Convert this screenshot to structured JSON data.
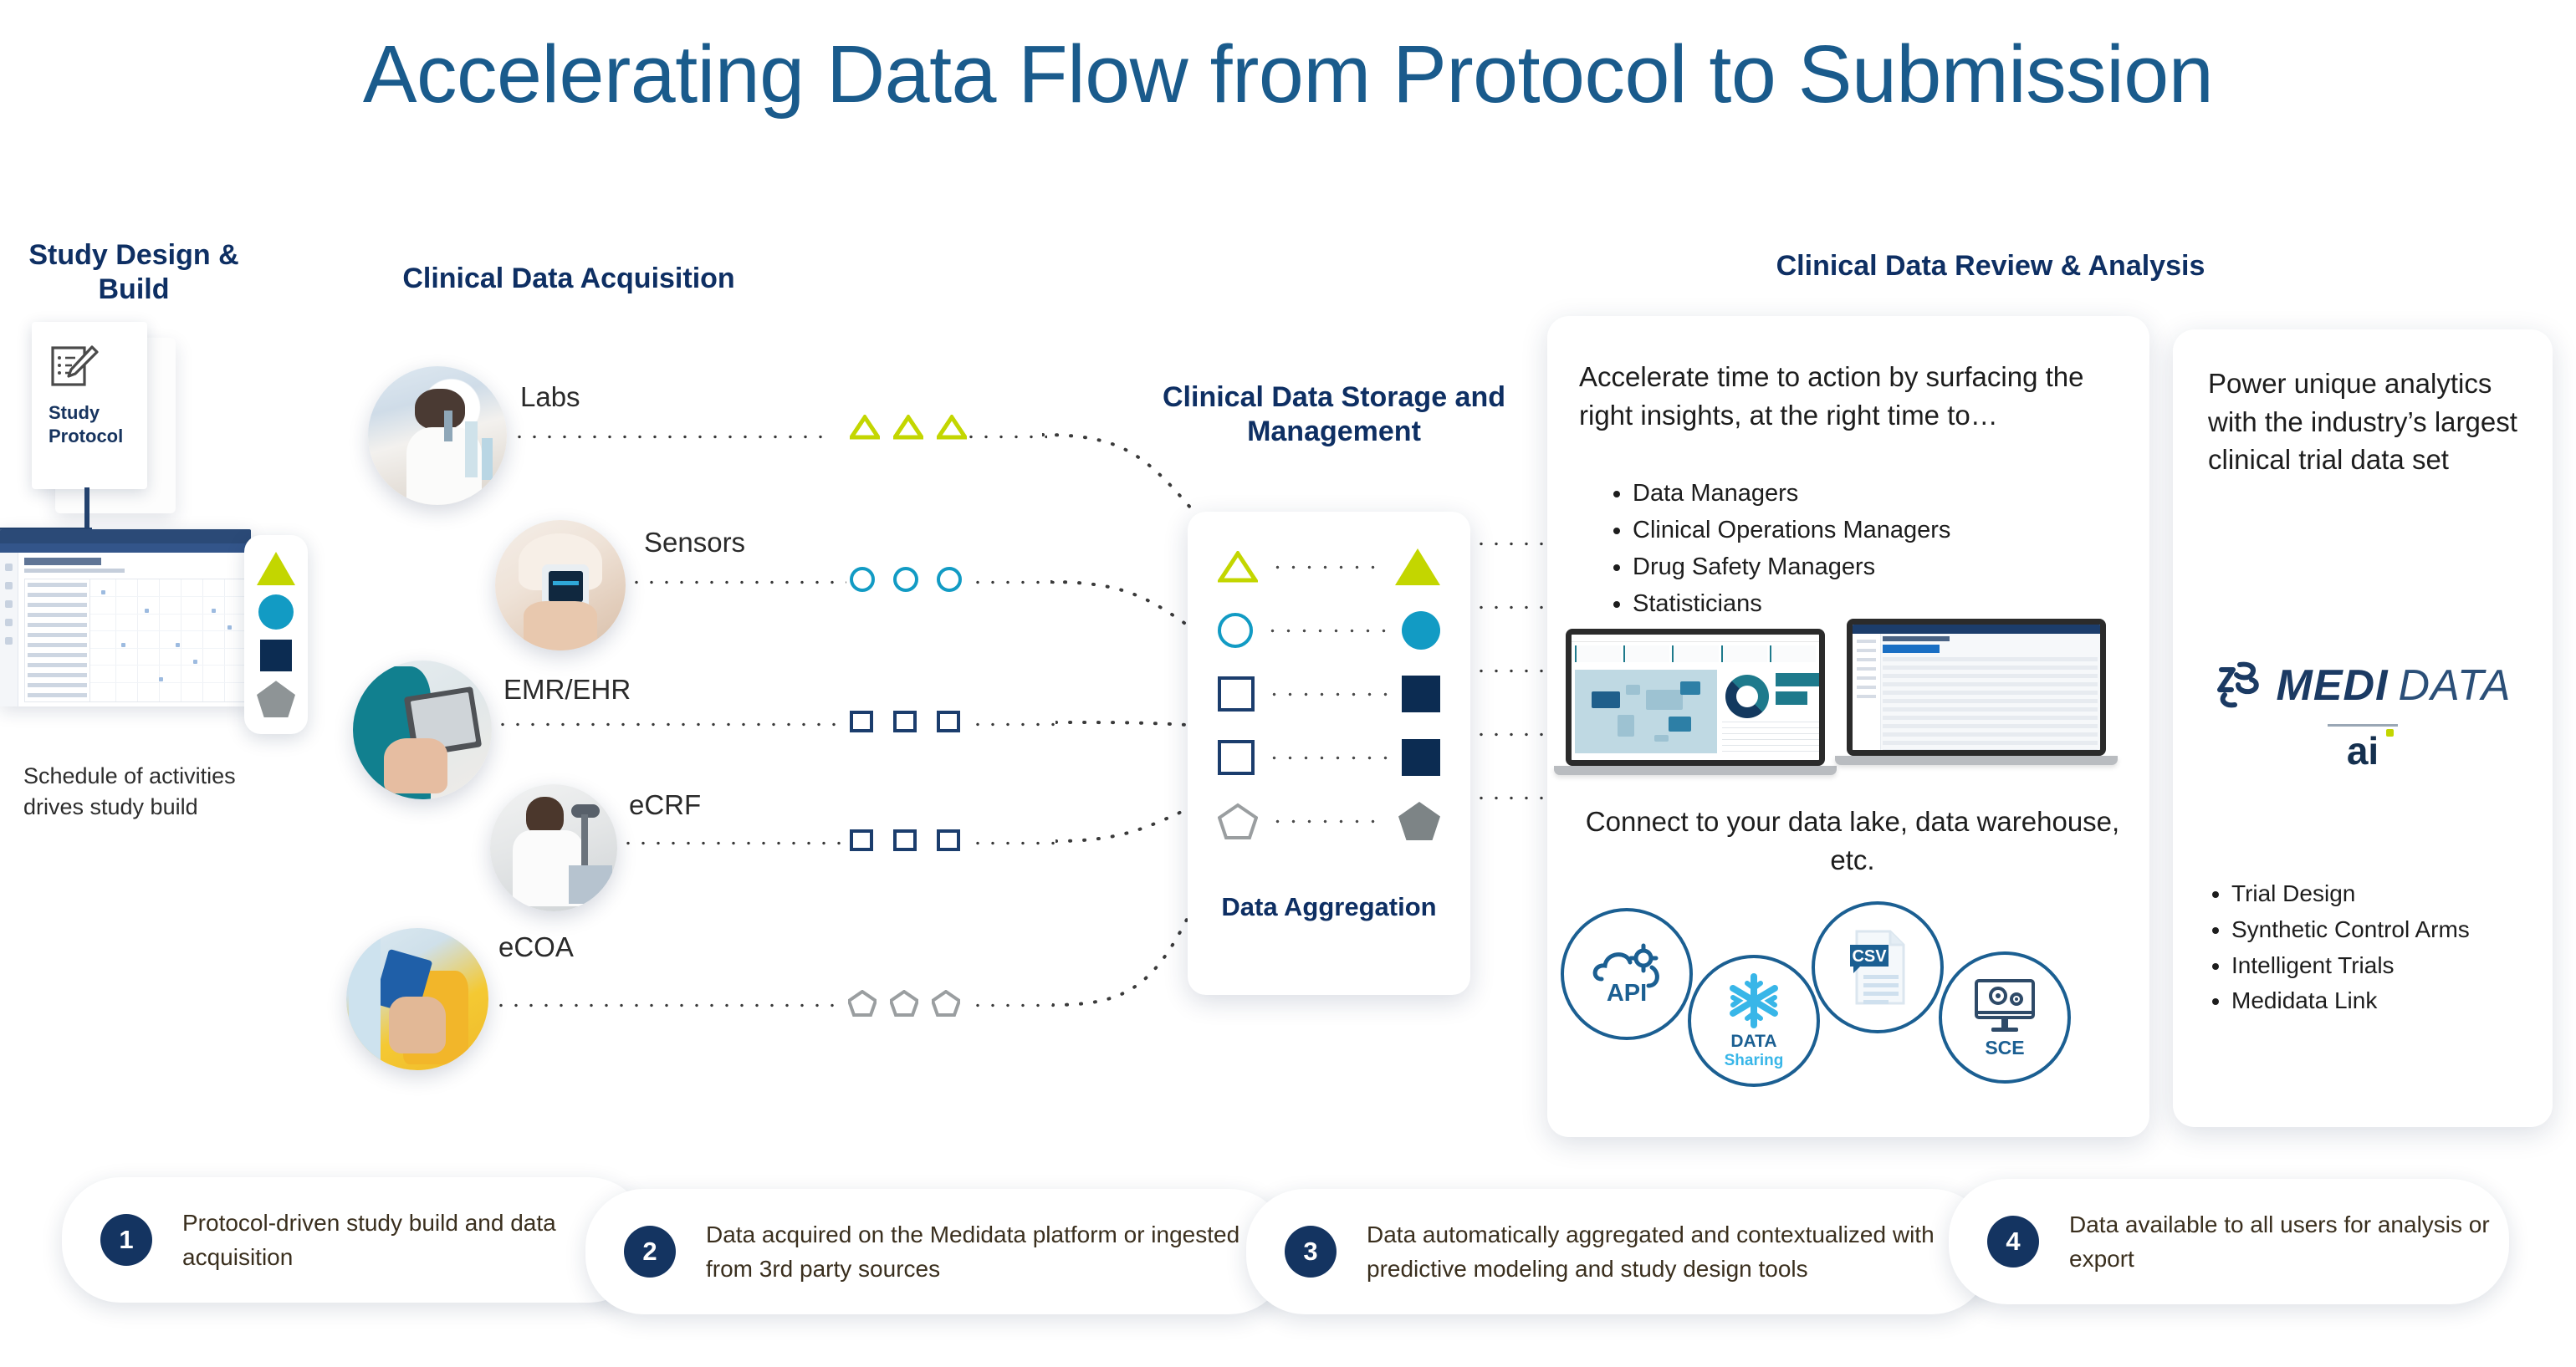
{
  "title": "Accelerating Data Flow from Protocol to Submission",
  "sections": {
    "study_design": "Study Design & Build",
    "acquisition": "Clinical Data Acquisition",
    "storage": "Clinical Data Storage and Management",
    "review": "Clinical Data Review & Analysis"
  },
  "study_design": {
    "protocol_card_label": "Study Protocol",
    "protocol_icon": "document-edit-icon",
    "soa_caption": "Schedule of activities drives study build",
    "shape_legend": [
      {
        "name": "triangle-marker",
        "color": "#c3d600"
      },
      {
        "name": "circle-marker",
        "color": "#129bc4"
      },
      {
        "name": "square-marker",
        "color": "#0c2c52"
      },
      {
        "name": "pentagon-marker",
        "color": "#8e9496"
      }
    ]
  },
  "acquisition": {
    "sources": [
      {
        "label": "Labs",
        "photo": "lab-scientist-photo",
        "marker": "triangle",
        "color": "#c3d600"
      },
      {
        "label": "Sensors",
        "photo": "wearable-sensor-photo",
        "marker": "circle",
        "color": "#129bc4"
      },
      {
        "label": "EMR/EHR",
        "photo": "clinician-tablet-photo",
        "marker": "square",
        "color": "#1b3d6d"
      },
      {
        "label": "eCRF",
        "photo": "researcher-desk-photo",
        "marker": "square",
        "color": "#1b3d6d"
      },
      {
        "label": "eCOA",
        "photo": "patient-phone-photo",
        "marker": "pentagon",
        "color": "#8e9496"
      }
    ]
  },
  "aggregation": {
    "label": "Data Aggregation",
    "rows": [
      {
        "shape": "triangle",
        "outline_color": "#c3d600",
        "filled_color": "#c3d600"
      },
      {
        "shape": "circle",
        "outline_color": "#129bc4",
        "filled_color": "#129bc4"
      },
      {
        "shape": "square",
        "outline_color": "#1b3d6d",
        "filled_color": "#0c2c52"
      },
      {
        "shape": "square",
        "outline_color": "#1b3d6d",
        "filled_color": "#0c2c52"
      },
      {
        "shape": "pentagon",
        "outline_color": "#8e9496",
        "filled_color": "#7d8486"
      }
    ]
  },
  "review_left": {
    "lead": "Accelerate time to action by surfacing the right insights, at the right time to…",
    "bullets": [
      "Data Managers",
      "Clinical Operations Managers",
      "Drug Safety Managers",
      "Statisticians"
    ],
    "connect_text": "Connect to your data lake, data warehouse, etc.",
    "badges": [
      {
        "name": "api-cloud-icon",
        "label": "API",
        "sublabel": ""
      },
      {
        "name": "snowflake-icon",
        "label": "DATA",
        "sublabel": "Sharing"
      },
      {
        "name": "csv-file-icon",
        "label": "CSV",
        "sublabel": ""
      },
      {
        "name": "sce-monitor-icon",
        "label": "SCE",
        "sublabel": ""
      }
    ]
  },
  "review_right": {
    "lead": "Power unique analytics with the industry’s largest clinical trial data set",
    "logo": {
      "brand_mark": "3DS",
      "word_bold": "MEDI",
      "word_thin": "DATA",
      "suffix": "ai"
    },
    "bullets": [
      "Trial Design",
      "Synthetic Control Arms",
      "Intelligent Trials",
      "Medidata Link"
    ]
  },
  "footer_steps": [
    {
      "number": "1",
      "text": "Protocol-driven study build and data acquisition"
    },
    {
      "number": "2",
      "text": "Data acquired on the Medidata platform or ingested from 3rd party sources"
    },
    {
      "number": "3",
      "text": "Data automatically aggregated and contextualized with predictive modeling and study design tools"
    },
    {
      "number": "4",
      "text": "Data available to all users for analysis or export"
    }
  ],
  "colors": {
    "title_blue": "#1a5b8c",
    "heading_navy": "#0e2f63",
    "accent_lime": "#c3d600",
    "accent_cyan": "#129bc4",
    "accent_navy": "#0c2c52",
    "accent_gray": "#8e9496",
    "badge_blue": "#1b5f92"
  }
}
